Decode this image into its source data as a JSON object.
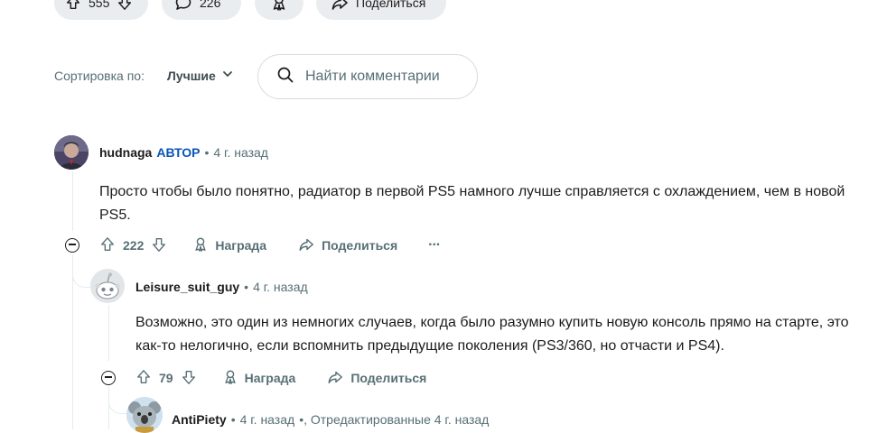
{
  "post_actions": {
    "upvotes": "555",
    "comments": "226",
    "share_label": "Поделиться"
  },
  "sort": {
    "label": "Сортировка по:",
    "selected": "Лучшие"
  },
  "search": {
    "placeholder": "Найти комментарии"
  },
  "comments": [
    {
      "author": "hudnaga",
      "badge": "АВТОР",
      "separator": "•",
      "time": "4 г. назад",
      "body": "Просто чтобы было понятно, радиатор в первой PS5 намного лучше справляется с охлаждением, чем в новой PS5.",
      "score": "222",
      "award_label": "Награда",
      "share_label": "Поделиться",
      "more": "···"
    },
    {
      "author": "Leisure_suit_guy",
      "separator": "•",
      "time": "4 г. назад",
      "body": "Возможно, это один из немногих случаев, когда было разумно купить новую консоль прямо на старте, это как-то нелогично, если вспомнить предыдущие поколения (PS3/360, но отчасти и PS4).",
      "score": "79",
      "award_label": "Награда",
      "share_label": "Поделиться"
    },
    {
      "author": "AntiPiety",
      "separator": "•",
      "time": "4 г. назад",
      "separator2": "•",
      "edited": ", Отредактированные 4 г. назад"
    }
  ]
}
